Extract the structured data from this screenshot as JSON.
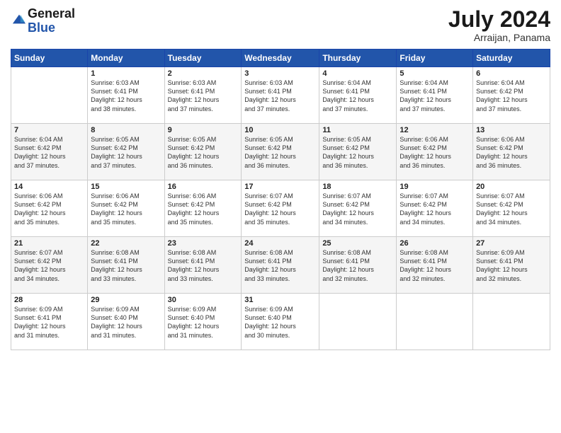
{
  "header": {
    "logo_general": "General",
    "logo_blue": "Blue",
    "month_title": "July 2024",
    "subtitle": "Arraijan, Panama"
  },
  "weekdays": [
    "Sunday",
    "Monday",
    "Tuesday",
    "Wednesday",
    "Thursday",
    "Friday",
    "Saturday"
  ],
  "weeks": [
    [
      {
        "day": "",
        "text": ""
      },
      {
        "day": "1",
        "text": "Sunrise: 6:03 AM\nSunset: 6:41 PM\nDaylight: 12 hours\nand 38 minutes."
      },
      {
        "day": "2",
        "text": "Sunrise: 6:03 AM\nSunset: 6:41 PM\nDaylight: 12 hours\nand 37 minutes."
      },
      {
        "day": "3",
        "text": "Sunrise: 6:03 AM\nSunset: 6:41 PM\nDaylight: 12 hours\nand 37 minutes."
      },
      {
        "day": "4",
        "text": "Sunrise: 6:04 AM\nSunset: 6:41 PM\nDaylight: 12 hours\nand 37 minutes."
      },
      {
        "day": "5",
        "text": "Sunrise: 6:04 AM\nSunset: 6:41 PM\nDaylight: 12 hours\nand 37 minutes."
      },
      {
        "day": "6",
        "text": "Sunrise: 6:04 AM\nSunset: 6:42 PM\nDaylight: 12 hours\nand 37 minutes."
      }
    ],
    [
      {
        "day": "7",
        "text": "Sunrise: 6:04 AM\nSunset: 6:42 PM\nDaylight: 12 hours\nand 37 minutes."
      },
      {
        "day": "8",
        "text": "Sunrise: 6:05 AM\nSunset: 6:42 PM\nDaylight: 12 hours\nand 37 minutes."
      },
      {
        "day": "9",
        "text": "Sunrise: 6:05 AM\nSunset: 6:42 PM\nDaylight: 12 hours\nand 36 minutes."
      },
      {
        "day": "10",
        "text": "Sunrise: 6:05 AM\nSunset: 6:42 PM\nDaylight: 12 hours\nand 36 minutes."
      },
      {
        "day": "11",
        "text": "Sunrise: 6:05 AM\nSunset: 6:42 PM\nDaylight: 12 hours\nand 36 minutes."
      },
      {
        "day": "12",
        "text": "Sunrise: 6:06 AM\nSunset: 6:42 PM\nDaylight: 12 hours\nand 36 minutes."
      },
      {
        "day": "13",
        "text": "Sunrise: 6:06 AM\nSunset: 6:42 PM\nDaylight: 12 hours\nand 36 minutes."
      }
    ],
    [
      {
        "day": "14",
        "text": "Sunrise: 6:06 AM\nSunset: 6:42 PM\nDaylight: 12 hours\nand 35 minutes."
      },
      {
        "day": "15",
        "text": "Sunrise: 6:06 AM\nSunset: 6:42 PM\nDaylight: 12 hours\nand 35 minutes."
      },
      {
        "day": "16",
        "text": "Sunrise: 6:06 AM\nSunset: 6:42 PM\nDaylight: 12 hours\nand 35 minutes."
      },
      {
        "day": "17",
        "text": "Sunrise: 6:07 AM\nSunset: 6:42 PM\nDaylight: 12 hours\nand 35 minutes."
      },
      {
        "day": "18",
        "text": "Sunrise: 6:07 AM\nSunset: 6:42 PM\nDaylight: 12 hours\nand 34 minutes."
      },
      {
        "day": "19",
        "text": "Sunrise: 6:07 AM\nSunset: 6:42 PM\nDaylight: 12 hours\nand 34 minutes."
      },
      {
        "day": "20",
        "text": "Sunrise: 6:07 AM\nSunset: 6:42 PM\nDaylight: 12 hours\nand 34 minutes."
      }
    ],
    [
      {
        "day": "21",
        "text": "Sunrise: 6:07 AM\nSunset: 6:42 PM\nDaylight: 12 hours\nand 34 minutes."
      },
      {
        "day": "22",
        "text": "Sunrise: 6:08 AM\nSunset: 6:41 PM\nDaylight: 12 hours\nand 33 minutes."
      },
      {
        "day": "23",
        "text": "Sunrise: 6:08 AM\nSunset: 6:41 PM\nDaylight: 12 hours\nand 33 minutes."
      },
      {
        "day": "24",
        "text": "Sunrise: 6:08 AM\nSunset: 6:41 PM\nDaylight: 12 hours\nand 33 minutes."
      },
      {
        "day": "25",
        "text": "Sunrise: 6:08 AM\nSunset: 6:41 PM\nDaylight: 12 hours\nand 32 minutes."
      },
      {
        "day": "26",
        "text": "Sunrise: 6:08 AM\nSunset: 6:41 PM\nDaylight: 12 hours\nand 32 minutes."
      },
      {
        "day": "27",
        "text": "Sunrise: 6:09 AM\nSunset: 6:41 PM\nDaylight: 12 hours\nand 32 minutes."
      }
    ],
    [
      {
        "day": "28",
        "text": "Sunrise: 6:09 AM\nSunset: 6:41 PM\nDaylight: 12 hours\nand 31 minutes."
      },
      {
        "day": "29",
        "text": "Sunrise: 6:09 AM\nSunset: 6:40 PM\nDaylight: 12 hours\nand 31 minutes."
      },
      {
        "day": "30",
        "text": "Sunrise: 6:09 AM\nSunset: 6:40 PM\nDaylight: 12 hours\nand 31 minutes."
      },
      {
        "day": "31",
        "text": "Sunrise: 6:09 AM\nSunset: 6:40 PM\nDaylight: 12 hours\nand 30 minutes."
      },
      {
        "day": "",
        "text": ""
      },
      {
        "day": "",
        "text": ""
      },
      {
        "day": "",
        "text": ""
      }
    ]
  ]
}
